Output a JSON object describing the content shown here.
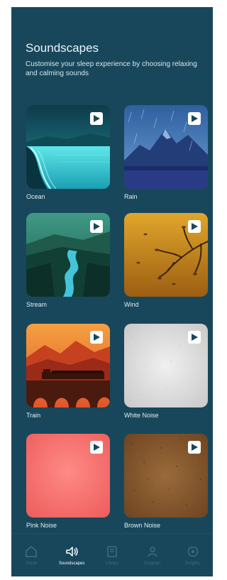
{
  "header": {
    "title": "Soundscapes",
    "subtitle": "Customise your sleep experience by choosing relaxing and calming sounds"
  },
  "sounds": [
    {
      "label": "Ocean",
      "icon": "play-icon"
    },
    {
      "label": "Rain",
      "icon": "play-icon"
    },
    {
      "label": "Stream",
      "icon": "play-icon"
    },
    {
      "label": "Wind",
      "icon": "play-icon"
    },
    {
      "label": "Train",
      "icon": "play-icon"
    },
    {
      "label": "White Noise",
      "icon": "play-icon"
    },
    {
      "label": "Pink Noise",
      "icon": "play-icon"
    },
    {
      "label": "Brown Noise",
      "icon": "play-icon"
    }
  ],
  "nav": {
    "items": [
      {
        "label": "Home",
        "icon": "home-icon",
        "active": false
      },
      {
        "label": "Soundscapes",
        "icon": "speaker-icon",
        "active": true
      },
      {
        "label": "Library",
        "icon": "library-icon",
        "active": false
      },
      {
        "label": "Program",
        "icon": "program-icon",
        "active": false
      },
      {
        "label": "Insights",
        "icon": "insights-icon",
        "active": false
      }
    ]
  },
  "colors": {
    "background": "#18475b",
    "text": "#eaf4f7",
    "active_nav": "#ffffff",
    "inactive_nav": "#3a6f85"
  }
}
